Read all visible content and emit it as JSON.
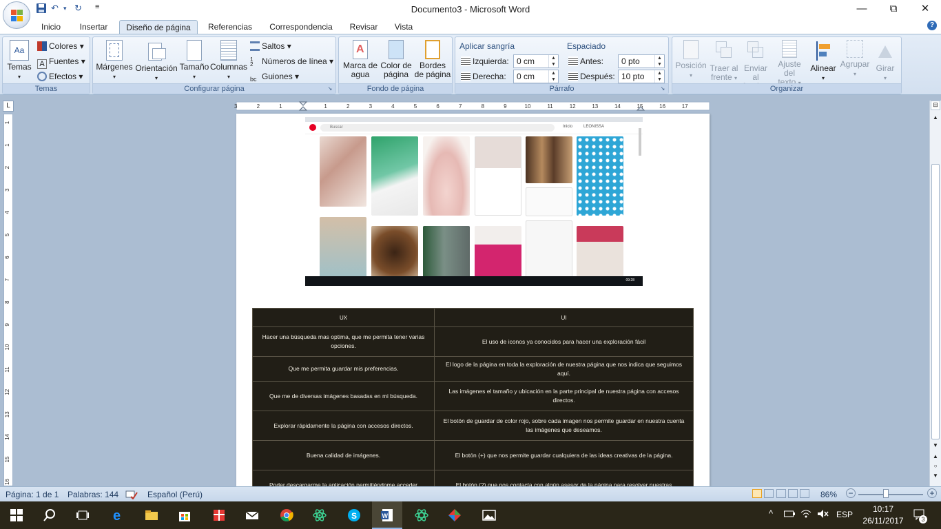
{
  "window": {
    "title": "Documento3 - Microsoft Word",
    "minimize_glyph": "—",
    "restore_glyph": "⧉",
    "close_glyph": "✕",
    "qat": {
      "save_icon": "save-icon",
      "undo_icon": "undo-icon",
      "redo_icon": "redo-icon",
      "undo_arrow": "↶",
      "redo_arrow": "↻",
      "dropdown": "▾",
      "customize": "≡"
    }
  },
  "tabs": [
    {
      "label": "Inicio"
    },
    {
      "label": "Insertar"
    },
    {
      "label": "Diseño de página",
      "active": true
    },
    {
      "label": "Referencias"
    },
    {
      "label": "Correspondencia"
    },
    {
      "label": "Revisar"
    },
    {
      "label": "Vista"
    }
  ],
  "help_glyph": "?",
  "ribbon": {
    "temas": {
      "group_label": "Temas",
      "temas_label": "Temas",
      "colores": "Colores",
      "fuentes": "Fuentes",
      "efectos": "Efectos",
      "temas_icon_text": "Aa"
    },
    "configurar": {
      "group_label": "Configurar página",
      "margenes": "Márgenes",
      "orientacion": "Orientación",
      "tamano": "Tamaño",
      "columnas": "Columnas",
      "saltos": "Saltos",
      "numeros_linea": "Números de línea",
      "guiones": "Guiones"
    },
    "fondo": {
      "group_label": "Fondo de página",
      "marca_agua": [
        "Marca de",
        "agua"
      ],
      "color_pagina": [
        "Color de",
        "página"
      ],
      "bordes_pagina": [
        "Bordes",
        "de página"
      ]
    },
    "parrafo": {
      "group_label": "Párrafo",
      "aplicar_sangria": "Aplicar sangría",
      "izquierda_label": "Izquierda:",
      "izquierda_value": "0 cm",
      "derecha_label": "Derecha:",
      "derecha_value": "0 cm",
      "espaciado": "Espaciado",
      "antes_label": "Antes:",
      "antes_value": "0 pto",
      "despues_label": "Después:",
      "despues_value": "10 pto"
    },
    "organizar": {
      "group_label": "Organizar",
      "posicion": "Posición",
      "traer_frente": [
        "Traer al",
        "frente"
      ],
      "enviar_fondo": [
        "Enviar al",
        "fondo"
      ],
      "ajuste_texto": [
        "Ajuste del",
        "texto"
      ],
      "alinear": "Alinear",
      "agrupar": "Agrupar",
      "girar": "Girar"
    }
  },
  "ruler": {
    "corner_glyph": "L",
    "ticks": [
      "3",
      "2",
      "1",
      "1",
      "2",
      "3",
      "4",
      "5",
      "6",
      "7",
      "8",
      "9",
      "10",
      "11",
      "12",
      "13",
      "14",
      "15",
      "16",
      "17"
    ],
    "vticks": [
      "1",
      "1",
      "2",
      "3",
      "4",
      "5",
      "6",
      "7",
      "8",
      "9",
      "10",
      "11",
      "12",
      "13",
      "14",
      "15",
      "16",
      "17"
    ]
  },
  "screenshot": {
    "search_placeholder": "Buscar",
    "user_label": "Inicio",
    "user_name": "LEONISSA",
    "clock": "09:28"
  },
  "table": {
    "headers": [
      "UX",
      "UI"
    ],
    "rows": [
      [
        "Hacer una búsqueda  mas optima,  que me permita tener varias opciones.",
        "El uso de iconos  ya conocidos  para hacer una exploración  fácil"
      ],
      [
        "Que me permita guardar mis preferencias.",
        "El logo de la página en toda la exploración  de nuestra página que nos indica que seguimos aquí."
      ],
      [
        "Que me de diversas imágenes basadas en mi búsqueda.",
        "Las imágenes el tamaño y ubicación  en la parte principal de nuestra página con accesos directos."
      ],
      [
        "Explorar rápidamente  la página con accesos directos.",
        "El botón de guardar de color rojo, sobre cada imagen nos permite guardar en nuestra cuenta las imágenes que deseamos."
      ],
      [
        "Buena calidad de imágenes.",
        "El botón (+) que nos permite guardar cualquiera  de las ideas creativas de la página."
      ],
      [
        "Poder descargarme la aplicación  permitiéndome  acceder",
        "El botón (?) que nos contacta  con algún asesor de la página para resolver nuestras"
      ]
    ]
  },
  "statusbar": {
    "pagina": "Página: 1 de 1",
    "palabras": "Palabras: 144",
    "idioma": "Español (Perú)",
    "zoom": "86%",
    "zoom_minus": "−",
    "zoom_plus": "+"
  },
  "taskbar": {
    "time": "10:17",
    "date": "26/11/2017",
    "lang": "ESP",
    "notif_count": "3",
    "tray_up": "^",
    "tray_mute": "🔇"
  },
  "colors": {
    "ribbon": "#dce7f4",
    "table_bg": "#211e16",
    "taskbar": "#2a2618",
    "word_blue": "#2b579a"
  }
}
